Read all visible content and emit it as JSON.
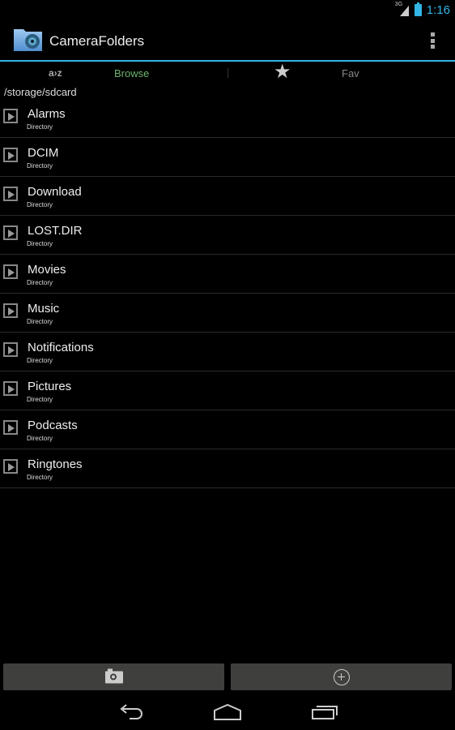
{
  "status_bar": {
    "network": "3G",
    "time": "1:16"
  },
  "action_bar": {
    "title": "CameraFolders",
    "accent_color": "#33b5e5"
  },
  "tabs": {
    "sort_label": "a›z",
    "browse_label": "Browse",
    "fav_label": "Fav",
    "active": "Browse"
  },
  "path": "/storage/sdcard",
  "entries": [
    {
      "name": "Alarms",
      "type": "Directory"
    },
    {
      "name": "DCIM",
      "type": "Directory"
    },
    {
      "name": "Download",
      "type": "Directory"
    },
    {
      "name": "LOST.DIR",
      "type": "Directory"
    },
    {
      "name": "Movies",
      "type": "Directory"
    },
    {
      "name": "Music",
      "type": "Directory"
    },
    {
      "name": "Notifications",
      "type": "Directory"
    },
    {
      "name": "Pictures",
      "type": "Directory"
    },
    {
      "name": "Podcasts",
      "type": "Directory"
    },
    {
      "name": "Ringtones",
      "type": "Directory"
    }
  ],
  "bottom_buttons": {
    "camera_icon": "camera-icon",
    "add_icon": "add-circle-icon"
  },
  "nav_bar": [
    "back",
    "home",
    "recents"
  ]
}
